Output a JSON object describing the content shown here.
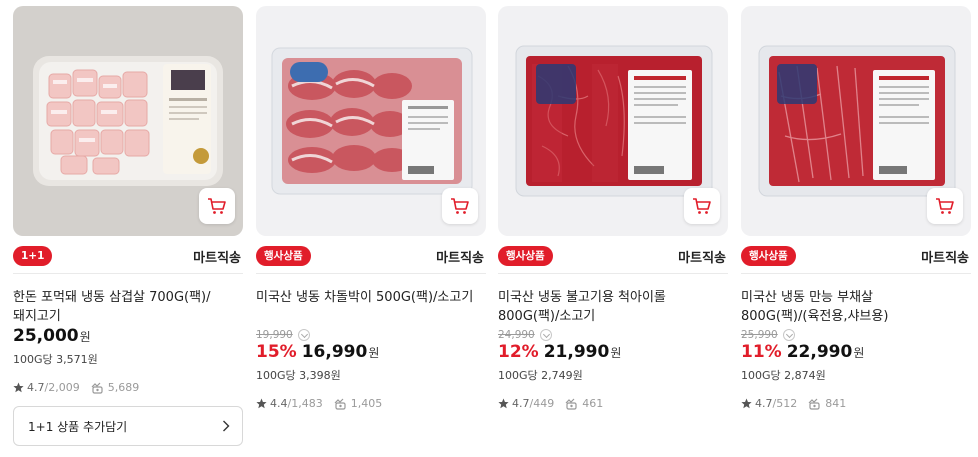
{
  "colors": {
    "accent": "#e11d2a",
    "text": "#222222",
    "muted": "#9a9a9a"
  },
  "products": [
    {
      "badge": "1+1",
      "delivery": "마트직송",
      "title": "한돈 포먹돼 냉동 삼겹살 700G(팩)/돼지고기",
      "original_price": "",
      "discount": "",
      "price": "25,000",
      "won": "원",
      "unit_price": "100G당 3,571원",
      "rating": "4.7",
      "rating_count": "/2,009",
      "reviews": "5,689",
      "extra_button": "1+1 상품 추가담기"
    },
    {
      "badge": "행사상품",
      "delivery": "마트직송",
      "title": "미국산 냉동 차돌박이 500G(팩)/소고기",
      "original_price": "19,990",
      "discount": "15%",
      "price": "16,990",
      "won": "원",
      "unit_price": "100G당 3,398원",
      "rating": "4.4",
      "rating_count": "/1,483",
      "reviews": "1,405"
    },
    {
      "badge": "행사상품",
      "delivery": "마트직송",
      "title": "미국산 냉동 불고기용 척아이롤 800G(팩)/소고기",
      "original_price": "24,990",
      "discount": "12%",
      "price": "21,990",
      "won": "원",
      "unit_price": "100G당 2,749원",
      "rating": "4.7",
      "rating_count": "/449",
      "reviews": "461"
    },
    {
      "badge": "행사상품",
      "delivery": "마트직송",
      "title": "미국산 냉동 만능 부채살 800G(팩)/(육전용,샤브용)",
      "original_price": "25,990",
      "discount": "11%",
      "price": "22,990",
      "won": "원",
      "unit_price": "100G당 2,874원",
      "rating": "4.7",
      "rating_count": "/512",
      "reviews": "841"
    }
  ]
}
